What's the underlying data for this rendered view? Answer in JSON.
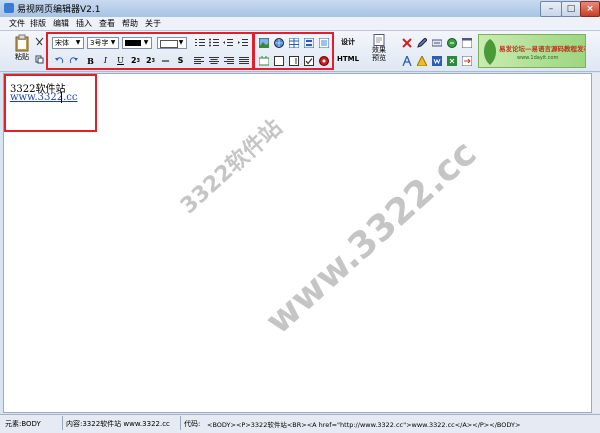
{
  "window": {
    "title": "易视网页编辑器V2.1"
  },
  "menu": [
    "文件",
    "排版",
    "编辑",
    "插入",
    "查看",
    "帮助",
    "关于"
  ],
  "toolbar": {
    "paste_label": "粘贴",
    "font_name": "宋体",
    "font_size": "3号字",
    "design_label": "设计",
    "html_label": "HTML",
    "preview_label": "效果预览",
    "banner_text": "易发论坛—易语言源码教程发布社区",
    "banner_url": "www.1dayit.com"
  },
  "editor": {
    "text": "3322软件站",
    "link": "www.3322.cc"
  },
  "watermarks": [
    "3322软件站",
    "www.3322.cc"
  ],
  "status": {
    "element": "元素:BODY",
    "content": "内容:3322软件站  www.3322.cc",
    "code_label": "代码:",
    "code": "<BODY><P>3322软件站<BR><A href=\"http://www.3322.cc\">www.3322.cc</A></P></BODY>"
  },
  "colors": {
    "highlight": "#e0202a",
    "link": "#1a3fc0"
  }
}
